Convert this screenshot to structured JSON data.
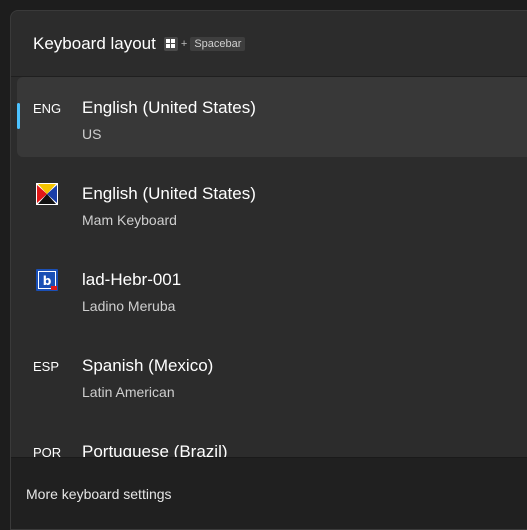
{
  "flyout": {
    "title": "Keyboard layout",
    "shortcut": {
      "key_icon": "windows-key-icon",
      "plus": "+",
      "key2": "Spacebar"
    }
  },
  "layouts": [
    {
      "abbr": "ENG",
      "icon": null,
      "name": "English (United States)",
      "sub": "US",
      "selected": true
    },
    {
      "abbr": "",
      "icon": "mam-keyboard-icon",
      "name": "English (United States)",
      "sub": "Mam Keyboard",
      "selected": false
    },
    {
      "abbr": "",
      "icon": "ladino-keyboard-icon",
      "name": "lad-Hebr-001",
      "sub": "Ladino Meruba",
      "selected": false
    },
    {
      "abbr": "ESP",
      "icon": null,
      "name": "Spanish (Mexico)",
      "sub": "Latin American",
      "selected": false
    },
    {
      "abbr": "POR",
      "icon": null,
      "name": "Portuguese (Brazil)",
      "sub": "",
      "selected": false
    }
  ],
  "footer": {
    "link": "More keyboard settings"
  },
  "colors": {
    "accent": "#4cc2ff",
    "background": "#2c2c2c",
    "footer": "#202020"
  }
}
